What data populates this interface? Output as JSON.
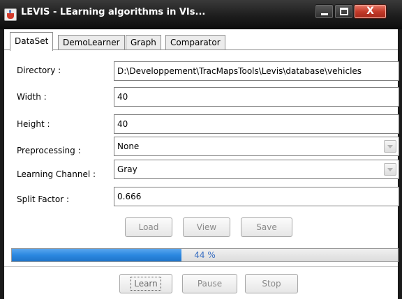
{
  "window": {
    "title": "LEVIS -  LEarning algorithms in VIs...",
    "close_glyph": "X"
  },
  "tabs": [
    {
      "label": "DataSet",
      "active": true
    },
    {
      "label": "DemoLearner",
      "active": false
    },
    {
      "label": "Graph",
      "active": false
    },
    {
      "label": "Comparator",
      "active": false
    }
  ],
  "form": {
    "directory": {
      "label": "Directory :",
      "value": "D:\\Developpement\\TracMapsTools\\Levis\\database\\vehicles"
    },
    "width": {
      "label": "Width :",
      "value": "40"
    },
    "height": {
      "label": "Height :",
      "value": "40"
    },
    "preprocessing": {
      "label": "Preprocessing :",
      "value": "None"
    },
    "learning_channel": {
      "label": "Learning Channel :",
      "value": "Gray"
    },
    "split_factor": {
      "label": "Split Factor :",
      "value": "0.666"
    }
  },
  "data_buttons": {
    "load": "Load",
    "view": "View",
    "save": "Save"
  },
  "progress": {
    "value": 0.44,
    "text": "44 %"
  },
  "control_buttons": {
    "learn": "Learn",
    "pause": "Pause",
    "stop": "Stop"
  },
  "colors": {
    "progress_fill": "#2b88e0",
    "progress_text": "#3a6fc2",
    "close_button": "#c43b2a"
  }
}
